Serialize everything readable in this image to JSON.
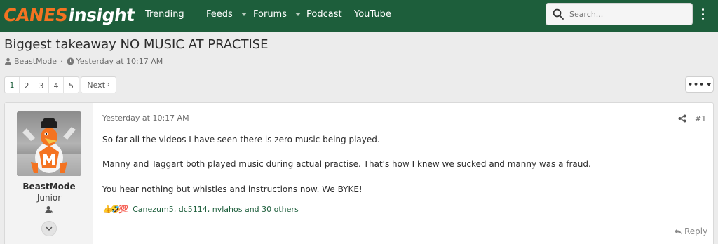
{
  "header": {
    "logo_part1": "CANES",
    "logo_part2": "INSIGHT",
    "nav": [
      {
        "label": "Trending",
        "has_dropdown": false
      },
      {
        "label": "Feeds",
        "has_dropdown": true
      },
      {
        "label": "Forums",
        "has_dropdown": true
      },
      {
        "label": "Podcast",
        "has_dropdown": false
      },
      {
        "label": "YouTube",
        "has_dropdown": false
      }
    ],
    "search_placeholder": "Search...",
    "search_icon": "search-icon",
    "menu_icon": "kebab-menu-icon"
  },
  "thread": {
    "title": "Biggest takeaway NO MUSIC AT PRACTISE",
    "author": "BeastMode",
    "separator": "·",
    "date": "Yesterday at 10:17 AM"
  },
  "pagination": {
    "pages": [
      "1",
      "2",
      "3",
      "4",
      "5"
    ],
    "current": "1",
    "next_label": "Next",
    "next_chevron": "›",
    "more_label": "•••"
  },
  "post": {
    "user": {
      "name": "BeastMode",
      "rank": "Junior"
    },
    "date": "Yesterday at 10:17 AM",
    "number": "#1",
    "lines": [
      "So far all the videos I have seen there is zero music being played.",
      "Manny and Taggart both played music during actual practise. That's how I knew we sucked and manny was a fraud.",
      "You hear nothing but whistles and instructions now. We BYKE!"
    ],
    "reactions": {
      "emojis": [
        "👍",
        "🤣",
        "💯"
      ],
      "names": "Canezum5, dc5114, nvlahos and 30 others"
    },
    "reply_label": "Reply"
  },
  "colors": {
    "brand_green": "#1d5e3b",
    "brand_orange": "#f47321"
  }
}
